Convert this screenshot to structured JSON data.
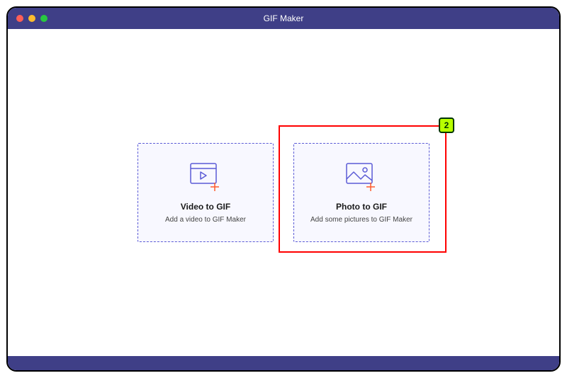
{
  "window": {
    "title": "GIF Maker"
  },
  "cards": {
    "video": {
      "title": "Video to GIF",
      "subtitle": "Add a video to GIF Maker"
    },
    "photo": {
      "title": "Photo to GIF",
      "subtitle": "Add some pictures to GIF Maker"
    }
  },
  "annotation": {
    "badge": "2"
  },
  "colors": {
    "titlebar": "#3f3f87",
    "dash": "#5b5bd6",
    "highlight": "#ff0000",
    "badge_bg": "#b8ff00"
  }
}
